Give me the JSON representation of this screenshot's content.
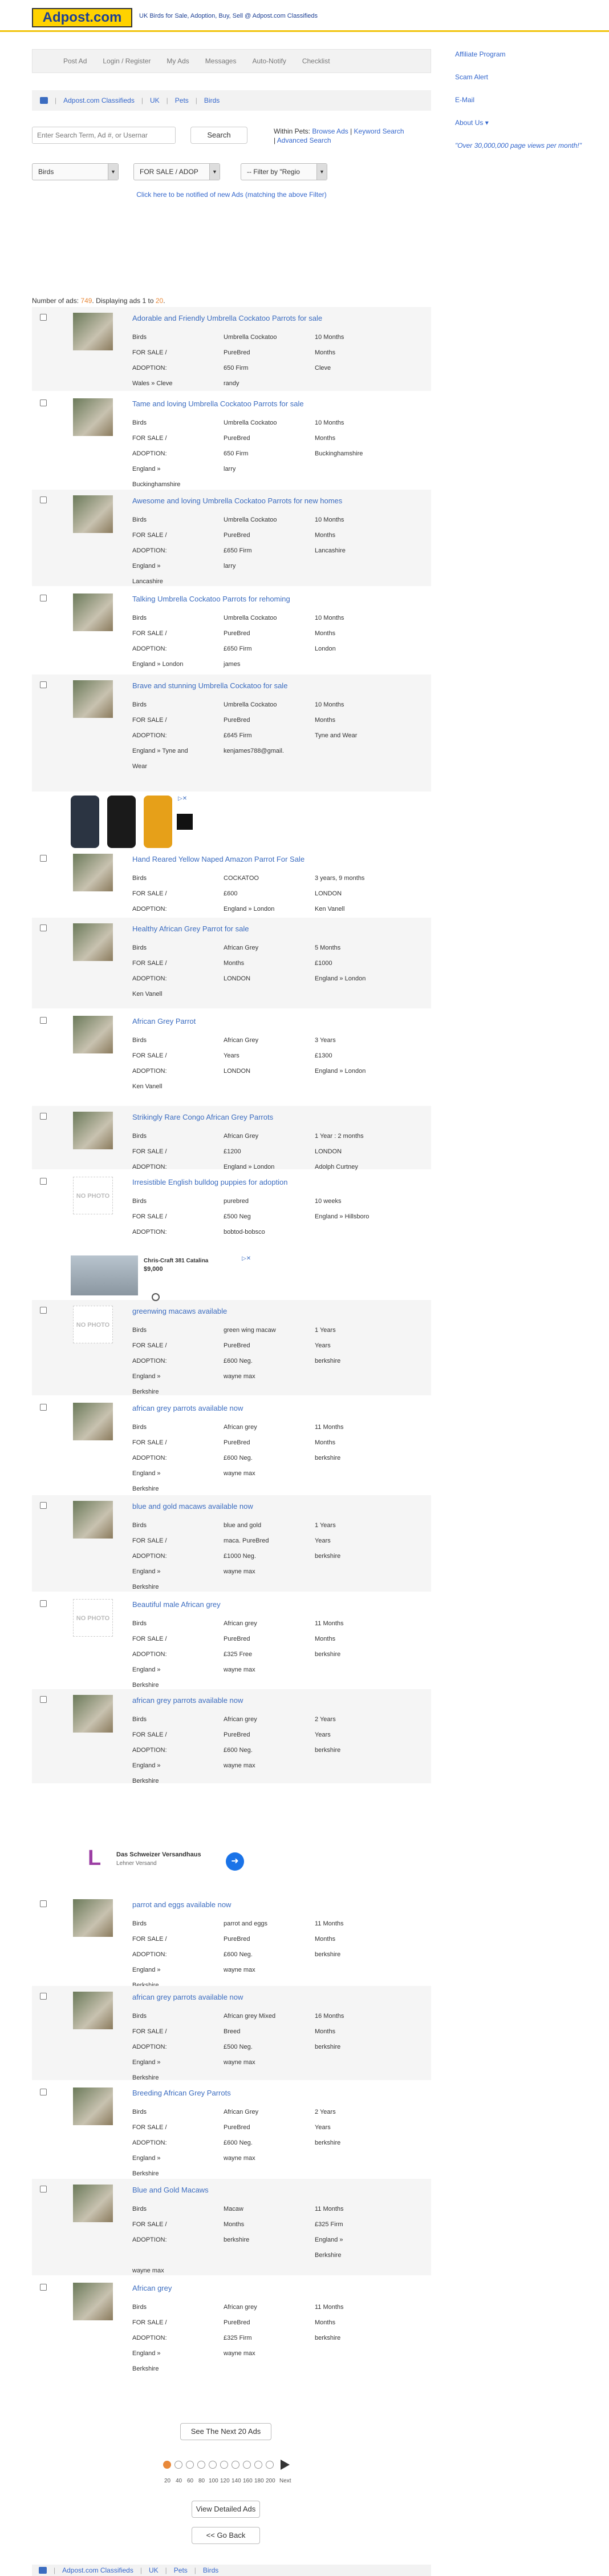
{
  "header": {
    "logo": "Adpost.com",
    "tagline": "UK Birds for Sale, Adoption, Buy, Sell @ Adpost.com Classifieds"
  },
  "nav": [
    "Post Ad",
    "Login / Register",
    "My Ads",
    "Messages",
    "Auto-Notify",
    "Checklist"
  ],
  "breadcrumb": [
    "Adpost.com Classifieds",
    "UK",
    "Pets",
    "Birds"
  ],
  "right": {
    "affiliate": "Affiliate Program",
    "scam": "Scam Alert",
    "email": "E-Mail",
    "about": "About Us ▾",
    "views": "\"Over 30,000,000 page views per month!\""
  },
  "search": {
    "placeholder": "Enter Search Term, Ad #, or Usernar",
    "button": "Search",
    "within_label": "Within Pets:",
    "browse": "Browse Ads",
    "keyword": "Keyword Search",
    "advanced": "Advanced Search"
  },
  "filters": {
    "category": "Birds",
    "type": "FOR SALE / ADOP",
    "region": "-- Filter by \"Regio"
  },
  "notify": "Click here to be notified of new Ads (matching the above Filter)",
  "count": {
    "prefix": "Number of ads:",
    "total": "749",
    "mid": ". Displaying ads",
    "from": "1",
    "to_word": "to",
    "to": "20",
    "suffix": "."
  },
  "ads": [
    {
      "title": "Adorable and Friendly Umbrella Cockatoo Parrots for sale",
      "cells": [
        "Birds",
        "Umbrella Cockatoo",
        "10 Months",
        "FOR SALE /",
        "PureBred",
        "Months",
        "ADOPTION:",
        "650 Firm",
        "Cleve",
        "Wales » Cleve",
        "randy",
        ""
      ]
    },
    {
      "title": "Tame and loving Umbrella Cockatoo Parrots for sale",
      "cells": [
        "Birds",
        "Umbrella Cockatoo",
        "10 Months",
        "FOR SALE /",
        "PureBred",
        "Months",
        "ADOPTION:",
        "650 Firm",
        "Buckinghamshire",
        "England »",
        "larry",
        "",
        "Buckinghamshire",
        "",
        ""
      ]
    },
    {
      "title": "Awesome and loving Umbrella Cockatoo Parrots for new homes",
      "cells": [
        "Birds",
        "Umbrella Cockatoo",
        "10 Months",
        "FOR SALE /",
        "PureBred",
        "Months",
        "ADOPTION:",
        "£650 Firm",
        "Lancashire",
        "England »",
        "larry",
        "",
        "Lancashire",
        "",
        ""
      ]
    },
    {
      "title": "Talking Umbrella Cockatoo Parrots for rehoming",
      "cells": [
        "Birds",
        "Umbrella Cockatoo",
        "10 Months",
        "FOR SALE /",
        "PureBred",
        "Months",
        "ADOPTION:",
        "£650 Firm",
        "London",
        "England » London",
        "james",
        ""
      ]
    },
    {
      "title": "Brave and stunning Umbrella Cockatoo for sale",
      "cells": [
        "Birds",
        "Umbrella Cockatoo",
        "10 Months",
        "FOR SALE /",
        "PureBred",
        "Months",
        "ADOPTION:",
        "£645 Firm",
        "Tyne and Wear",
        "England » Tyne and",
        "kenjames788@gmail.",
        "",
        "Wear",
        "",
        ""
      ]
    },
    {
      "title": "Hand Reared Yellow Naped Amazon Parrot For Sale",
      "cells": [
        "Birds",
        "COCKATOO",
        "3 years, 9 months",
        "FOR SALE /",
        "£600",
        "LONDON",
        "ADOPTION:",
        "England » London",
        "Ken Vanell"
      ]
    },
    {
      "title": "Healthy African Grey Parrot for sale",
      "cells": [
        "Birds",
        "African Grey",
        "5 Months",
        "FOR SALE /",
        "Months",
        "£1000",
        "ADOPTION:",
        "LONDON",
        "England » London",
        "Ken Vanell",
        "",
        ""
      ]
    },
    {
      "title": "African Grey Parrot",
      "cells": [
        "Birds",
        "African Grey",
        "3 Years",
        "FOR SALE /",
        "Years",
        "£1300",
        "ADOPTION:",
        "LONDON",
        "England » London",
        "Ken Vanell",
        "",
        ""
      ]
    },
    {
      "title": "Strikingly Rare Congo African Grey Parrots",
      "cells": [
        "Birds",
        "African Grey",
        "1 Year : 2 months",
        "FOR SALE /",
        "£1200",
        "LONDON",
        "ADOPTION:",
        "England » London",
        "Adolph Curtney"
      ]
    },
    {
      "title": "Irresistible English bulldog puppies for adoption",
      "cells": [
        "Birds",
        "purebred",
        "10 weeks",
        "FOR SALE /",
        "£500 Neg",
        "England » Hillsboro",
        "ADOPTION:",
        "bobtod-bobsco",
        ""
      ]
    },
    {
      "title": "greenwing macaws available",
      "cells": [
        "Birds",
        "green wing macaw",
        "1 Years",
        "FOR SALE /",
        "PureBred",
        "Years",
        "ADOPTION:",
        "£600 Neg.",
        "berkshire",
        "England »",
        "wayne max",
        "",
        "Berkshire",
        "",
        ""
      ]
    },
    {
      "title": "african grey parrots available now",
      "cells": [
        "Birds",
        "African grey",
        "11 Months",
        "FOR SALE /",
        "PureBred",
        "Months",
        "ADOPTION:",
        "£600 Neg.",
        "berkshire",
        "England »",
        "wayne max",
        "",
        "Berkshire",
        "",
        ""
      ]
    },
    {
      "title": "blue and gold macaws available now",
      "cells": [
        "Birds",
        "blue and gold",
        "1 Years",
        "FOR SALE /",
        "maca. PureBred",
        "Years",
        "ADOPTION:",
        "£1000 Neg.",
        "berkshire",
        "England »",
        "wayne max",
        "",
        "Berkshire",
        "",
        ""
      ]
    },
    {
      "title": "Beautiful male African grey",
      "cells": [
        "Birds",
        "African grey",
        "11 Months",
        "FOR SALE /",
        "PureBred",
        "Months",
        "ADOPTION:",
        "£325 Free",
        "berkshire",
        "England »",
        "wayne max",
        "",
        "Berkshire",
        "",
        ""
      ]
    },
    {
      "title": "african grey parrots available now",
      "cells": [
        "Birds",
        "African grey",
        "2 Years",
        "FOR SALE /",
        "PureBred",
        "Years",
        "ADOPTION:",
        "£600 Neg.",
        "berkshire",
        "England »",
        "wayne max",
        "",
        "Berkshire",
        "",
        ""
      ]
    },
    {
      "title": "parrot and eggs available now",
      "cells": [
        "Birds",
        "parrot and eggs",
        "11 Months",
        "FOR SALE /",
        "PureBred",
        "Months",
        "ADOPTION:",
        "£600 Neg.",
        "berkshire",
        "England »",
        "wayne max",
        "",
        "Berkshire",
        "",
        ""
      ]
    },
    {
      "title": "african grey parrots available now",
      "cells": [
        "Birds",
        "African grey Mixed",
        "16 Months",
        "FOR SALE /",
        "Breed",
        "Months",
        "ADOPTION:",
        "£500 Neg.",
        "berkshire",
        "England »",
        "wayne max",
        "",
        "Berkshire",
        "",
        ""
      ]
    },
    {
      "title": "Breeding African Grey Parrots",
      "cells": [
        "Birds",
        "African Grey",
        "2 Years",
        "FOR SALE /",
        "PureBred",
        "Years",
        "ADOPTION:",
        "£600 Neg.",
        "berkshire",
        "England »",
        "wayne max",
        "",
        "Berkshire",
        "",
        ""
      ]
    },
    {
      "title": "Blue and Gold Macaws",
      "cells": [
        "Birds",
        "Macaw",
        "11 Months",
        "FOR SALE /",
        "Months",
        "£325 Firm",
        "ADOPTION:",
        "berkshire",
        "England »",
        "",
        "",
        "Berkshire",
        "wayne max",
        "",
        ""
      ]
    },
    {
      "title": "African grey",
      "cells": [
        "Birds",
        "African grey",
        "11 Months",
        "FOR SALE /",
        "PureBred",
        "Months",
        "ADOPTION:",
        "£325 Firm",
        "berkshire",
        "England »",
        "wayne max",
        "",
        "Berkshire",
        "",
        ""
      ]
    }
  ],
  "promos": {
    "boat_title": "Chris-Craft 381 Catalina",
    "boat_price": "$9,000",
    "shop_title": "Das Schweizer Versandhaus",
    "shop_sub": "Lehner Versand"
  },
  "next": "See The Next 20 Ads",
  "pager_labels": [
    "20",
    "40",
    "60",
    "80",
    "100",
    "120",
    "140",
    "160",
    "180",
    "200",
    "Next"
  ],
  "view_detailed": "View Detailed Ads",
  "go_back": "<< Go Back",
  "no_photo": "NO PHOTO",
  "colors": {
    "accent": "#f1c40f",
    "link": "#3366cc",
    "count": "#e8893a"
  }
}
